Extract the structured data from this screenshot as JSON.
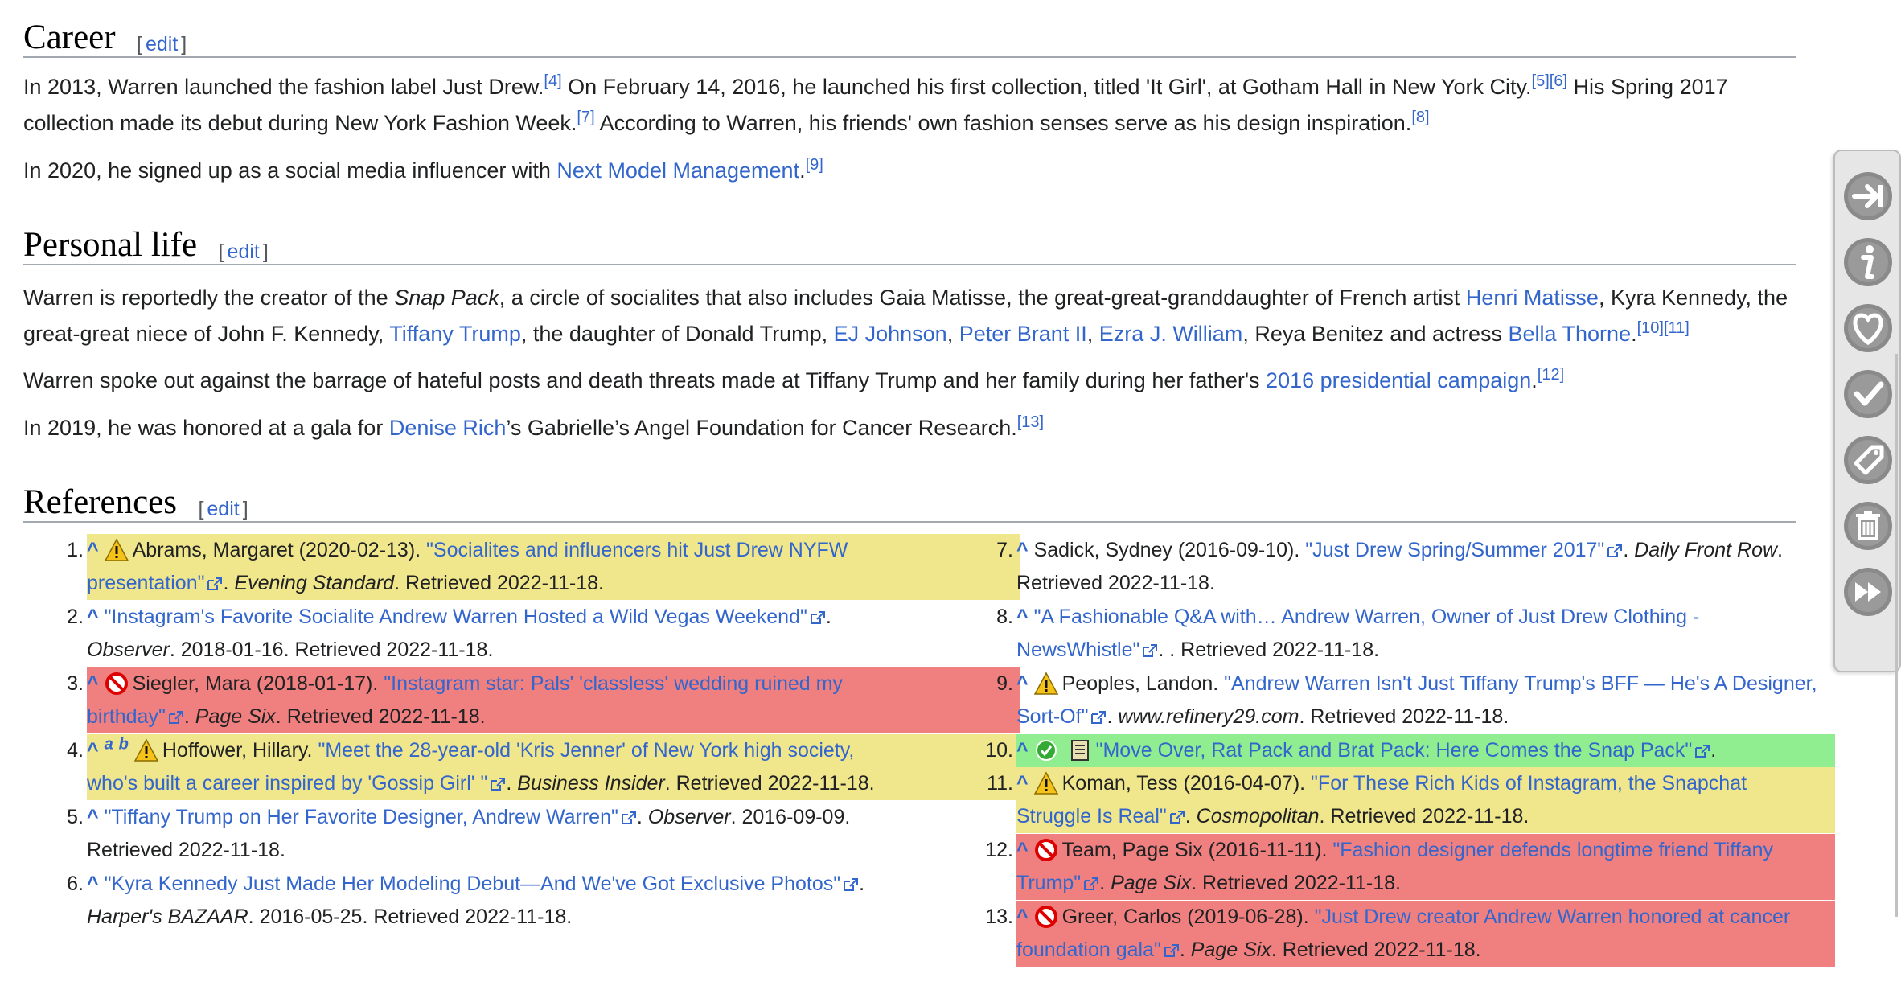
{
  "headings": {
    "career": "Career",
    "personal": "Personal life",
    "references": "References",
    "edit": "edit",
    "lbr": "[",
    "rbr": "]"
  },
  "career": {
    "p1": {
      "a": "In 2013, Warren launched the fashion label Just Drew.",
      "s1": "[4]",
      "b": " On February 14, 2016, he launched his first collection, titled 'It Girl', at Gotham Hall in New York City.",
      "s2": "[5]",
      "s3": "[6]",
      "c": " His Spring 2017",
      "d": "collection made its debut during New York Fashion Week.",
      "s4": "[7]",
      "e": " According to Warren, his friends' own fashion senses serve as his design inspiration.",
      "s5": "[8]"
    },
    "p2": {
      "a": "In 2020, he signed up as a social media influencer with ",
      "link": "Next Model Management",
      "b": ".",
      "s1": "[9]"
    }
  },
  "personal": {
    "p1": {
      "a": "Warren is reportedly the creator of the ",
      "snap": "Snap Pack",
      "b": ", a circle of socialites that also includes Gaia Matisse, the great-great-granddaughter of French artist ",
      "l1": "Henri Matisse",
      "c": ", Kyra Kennedy, the",
      "d": "great-great niece of John F. Kennedy, ",
      "l2": "Tiffany Trump",
      "e": ", the daughter of Donald Trump, ",
      "l3": "EJ Johnson",
      "f": ", ",
      "l4": "Peter Brant II",
      "g": ", ",
      "l5": "Ezra J. William",
      "h": ", Reya Benitez and actress ",
      "l6": "Bella Thorne",
      "i": ".",
      "s1": "[10]",
      "s2": "[11]"
    },
    "p2": {
      "a": "Warren spoke out against the barrage of hateful posts and death threats made at Tiffany Trump and her family during her father's ",
      "link": "2016 presidential campaign",
      "b": ".",
      "s1": "[12]"
    },
    "p3": {
      "a": "In 2019, he was honored at a gala for ",
      "link": "Denise Rich",
      "b": "’s Gabrielle’s Angel Foundation for Cancer Research.",
      "s1": "[13]"
    }
  },
  "references": [
    {
      "num": "1.",
      "caret": "^",
      "highlight": "#f0e68c",
      "icon": "warning-icon",
      "pre": "Abrams, Margaret (2020-02-13). ",
      "title1": "\"Socialites and influencers hit Just Drew NYFW",
      "title2": "presentation\"",
      "pub": "Evening Standard",
      "post": ". Retrieved 2022-11-18."
    },
    {
      "num": "2.",
      "caret": "^",
      "title1": "\"Instagram's Favorite Socialite Andrew Warren Hosted a Wild Vegas Weekend\"",
      "post1": ".",
      "pub": "Observer",
      "post": ". 2018-01-16. Retrieved 2022-11-18."
    },
    {
      "num": "3.",
      "caret": "^",
      "highlight": "#f08080",
      "icon": "blocked-icon",
      "pre": "Siegler, Mara (2018-01-17). ",
      "title1": "\"Instagram star: Pals' 'classless' wedding ruined my",
      "title2": "birthday\"",
      "pub": "Page Six",
      "post": ". Retrieved 2022-11-18."
    },
    {
      "num": "4.",
      "caret": "^",
      "a": "a",
      "b": "b",
      "highlight": "#f0e68c",
      "icon": "warning-icon",
      "pre": "Hoffower, Hillary. ",
      "title1": "\"Meet the 28-year-old 'Kris Jenner' of New York high society,",
      "title2": "who's built a career inspired by 'Gossip Girl' \"",
      "pub": "Business Insider",
      "post": ". Retrieved 2022-11-18."
    },
    {
      "num": "5.",
      "caret": "^",
      "title1": "\"Tiffany Trump on Her Favorite Designer, Andrew Warren\"",
      "post1": ". ",
      "pub": "Observer",
      "post1b": ". 2016-09-09.",
      "line2": "Retrieved 2022-11-18."
    },
    {
      "num": "6.",
      "caret": "^",
      "title1": "\"Kyra Kennedy Just Made Her Modeling Debut—And We've Got Exclusive Photos\"",
      "post1": ".",
      "pub": "Harper's BAZAAR",
      "post": ". 2016-05-25. Retrieved 2022-11-18."
    },
    {
      "num": "7.",
      "caret": "^",
      "pre": "Sadick, Sydney (2016-09-10). ",
      "title1": "\"Just Drew Spring/Summer 2017\"",
      "post1": ". ",
      "pub": "Daily Front Row",
      "post1b": ".",
      "line2": "Retrieved 2022-11-18."
    },
    {
      "num": "8.",
      "caret": "^",
      "title1": "\"A Fashionable Q&A with… Andrew Warren, Owner of Just Drew Clothing -",
      "title2": "NewsWhistle\"",
      "post": ". Retrieved 2022-11-18."
    },
    {
      "num": "9.",
      "caret": "^",
      "icon": "warning-icon",
      "pre": "Peoples, Landon. ",
      "title1": "\"Andrew Warren Isn't Just Tiffany Trump's BFF — He's A Designer,",
      "title2": "Sort-Of\"",
      "pub": "www.refinery29.com",
      "post": ". Retrieved 2022-11-18."
    },
    {
      "num": "10.",
      "caret": "^",
      "highlight": "#90ee90",
      "icon": "check-icon",
      "title1": "\"Move Over, Rat Pack and Brat Pack: Here Comes the Snap Pack\"",
      "post1": "."
    },
    {
      "num": "11.",
      "caret": "^",
      "highlight": "#f0e68c",
      "icon": "warning-icon",
      "pre": "Koman, Tess (2016-04-07). ",
      "title1": "\"For These Rich Kids of Instagram, the Snapchat",
      "title2": "Struggle Is Real\"",
      "pub": "Cosmopolitan",
      "post": ". Retrieved 2022-11-18."
    },
    {
      "num": "12.",
      "caret": "^",
      "highlight": "#f08080",
      "icon": "blocked-icon",
      "pre": "Team, Page Six (2016-11-11). ",
      "title1": "\"Fashion designer defends longtime friend Tiffany",
      "title2": "Trump\"",
      "pub": "Page Six",
      "post": ". Retrieved 2022-11-18."
    },
    {
      "num": "13.",
      "caret": "^",
      "highlight": "#f08080",
      "icon": "blocked-icon",
      "pre": "Greer, Carlos (2019-06-28). ",
      "title1": "\"Just Drew creator Andrew Warren honored at cancer",
      "title2": "foundation gala\"",
      "pub": "Page Six",
      "post": ". Retrieved 2022-11-18."
    }
  ],
  "toolbar": {
    "buttons": [
      "collapse-arrow-icon",
      "info-icon",
      "heart-icon",
      "check-icon",
      "tag-icon",
      "trash-icon",
      "fast-forward-icon"
    ]
  },
  "colors": {
    "link": "#3366cc",
    "warning": "#f0e68c",
    "blocked": "#f08080",
    "ok": "#90ee90"
  }
}
